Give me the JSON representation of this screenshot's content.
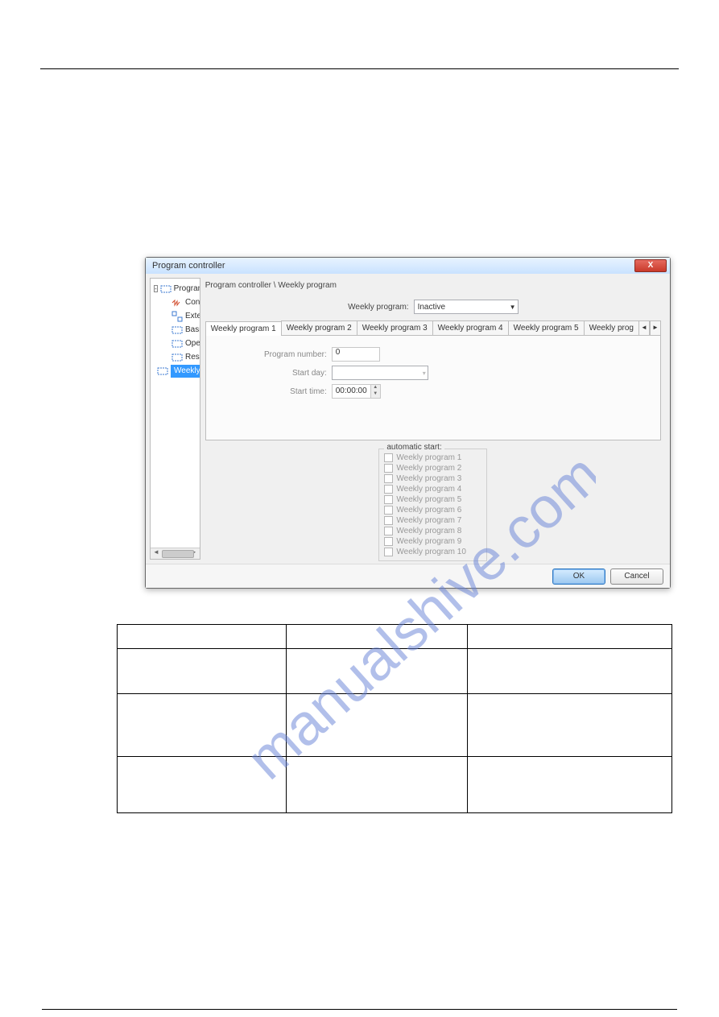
{
  "dialog": {
    "title": "Program controller",
    "breadcrumb": "Program controller \\ Weekly program",
    "tree": {
      "root": "Program controller",
      "items": [
        "Control signals",
        "Extented functions",
        "Basic status",
        "Operation mode Man",
        "Response by O-o-R",
        "Weekly program"
      ]
    },
    "weeklyProgramLabel": "Weekly program:",
    "weeklyProgramValue": "Inactive",
    "tabs": [
      "Weekly program 1",
      "Weekly program 2",
      "Weekly program 3",
      "Weekly program 4",
      "Weekly program 5",
      "Weekly prog"
    ],
    "fields": {
      "programNumberLabel": "Program number:",
      "programNumberValue": "0",
      "startDayLabel": "Start day:",
      "startDayValue": "",
      "startTimeLabel": "Start time:",
      "startTimeValue": "00:00:00"
    },
    "autoStart": {
      "legend": "automatic start:",
      "items": [
        "Weekly program 1",
        "Weekly program 2",
        "Weekly program 3",
        "Weekly program 4",
        "Weekly program 5",
        "Weekly program 6",
        "Weekly program 7",
        "Weekly program 8",
        "Weekly program 9",
        "Weekly program 10"
      ]
    },
    "buttons": {
      "ok": "OK",
      "cancel": "Cancel"
    },
    "closeX": "X"
  },
  "watermark": "manualshive.com"
}
